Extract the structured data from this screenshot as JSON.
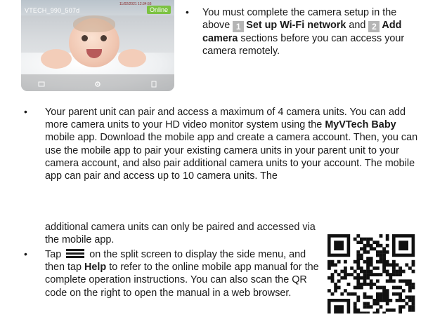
{
  "preview": {
    "camera_label": "VTECH_990_507d",
    "timestamp": "11/02/2021 12:34:56",
    "status_badge": "Online",
    "icons": [
      "gallery-icon",
      "settings-icon",
      "record-icon"
    ]
  },
  "note_top": {
    "before": "You must complete the camera setup in the above",
    "step1_num": "1",
    "step1_label": "Set up Wi-Fi network",
    "and": "and",
    "step2_num": "2",
    "step2_label": "Add camera",
    "after": "sections before you can access your camera remotely."
  },
  "para1": {
    "t1": "Your parent unit can pair and access a maximum of 4 camera units. You can add more camera units to your HD video monitor system using the",
    "app_name": "MyVTech Baby",
    "t2": "mobile app. Download the mobile app and create a camera account. Then, you can use the mobile app to pair your existing camera units in your parent unit to your camera account, and also pair additional camera units to your account. The mobile app can pair and access up to 10 camera units. The",
    "t3": "additional camera units can only be paired and accessed via the mobile app."
  },
  "para2": {
    "t1": "Tap",
    "t2": "on the split screen to display the side menu, and then tap",
    "help": "Help",
    "t3": "to refer to the online mobile app manual for the complete operation instructions. You can also scan the QR code on the right to open the manual in a web browser."
  },
  "bullet_char": "•"
}
